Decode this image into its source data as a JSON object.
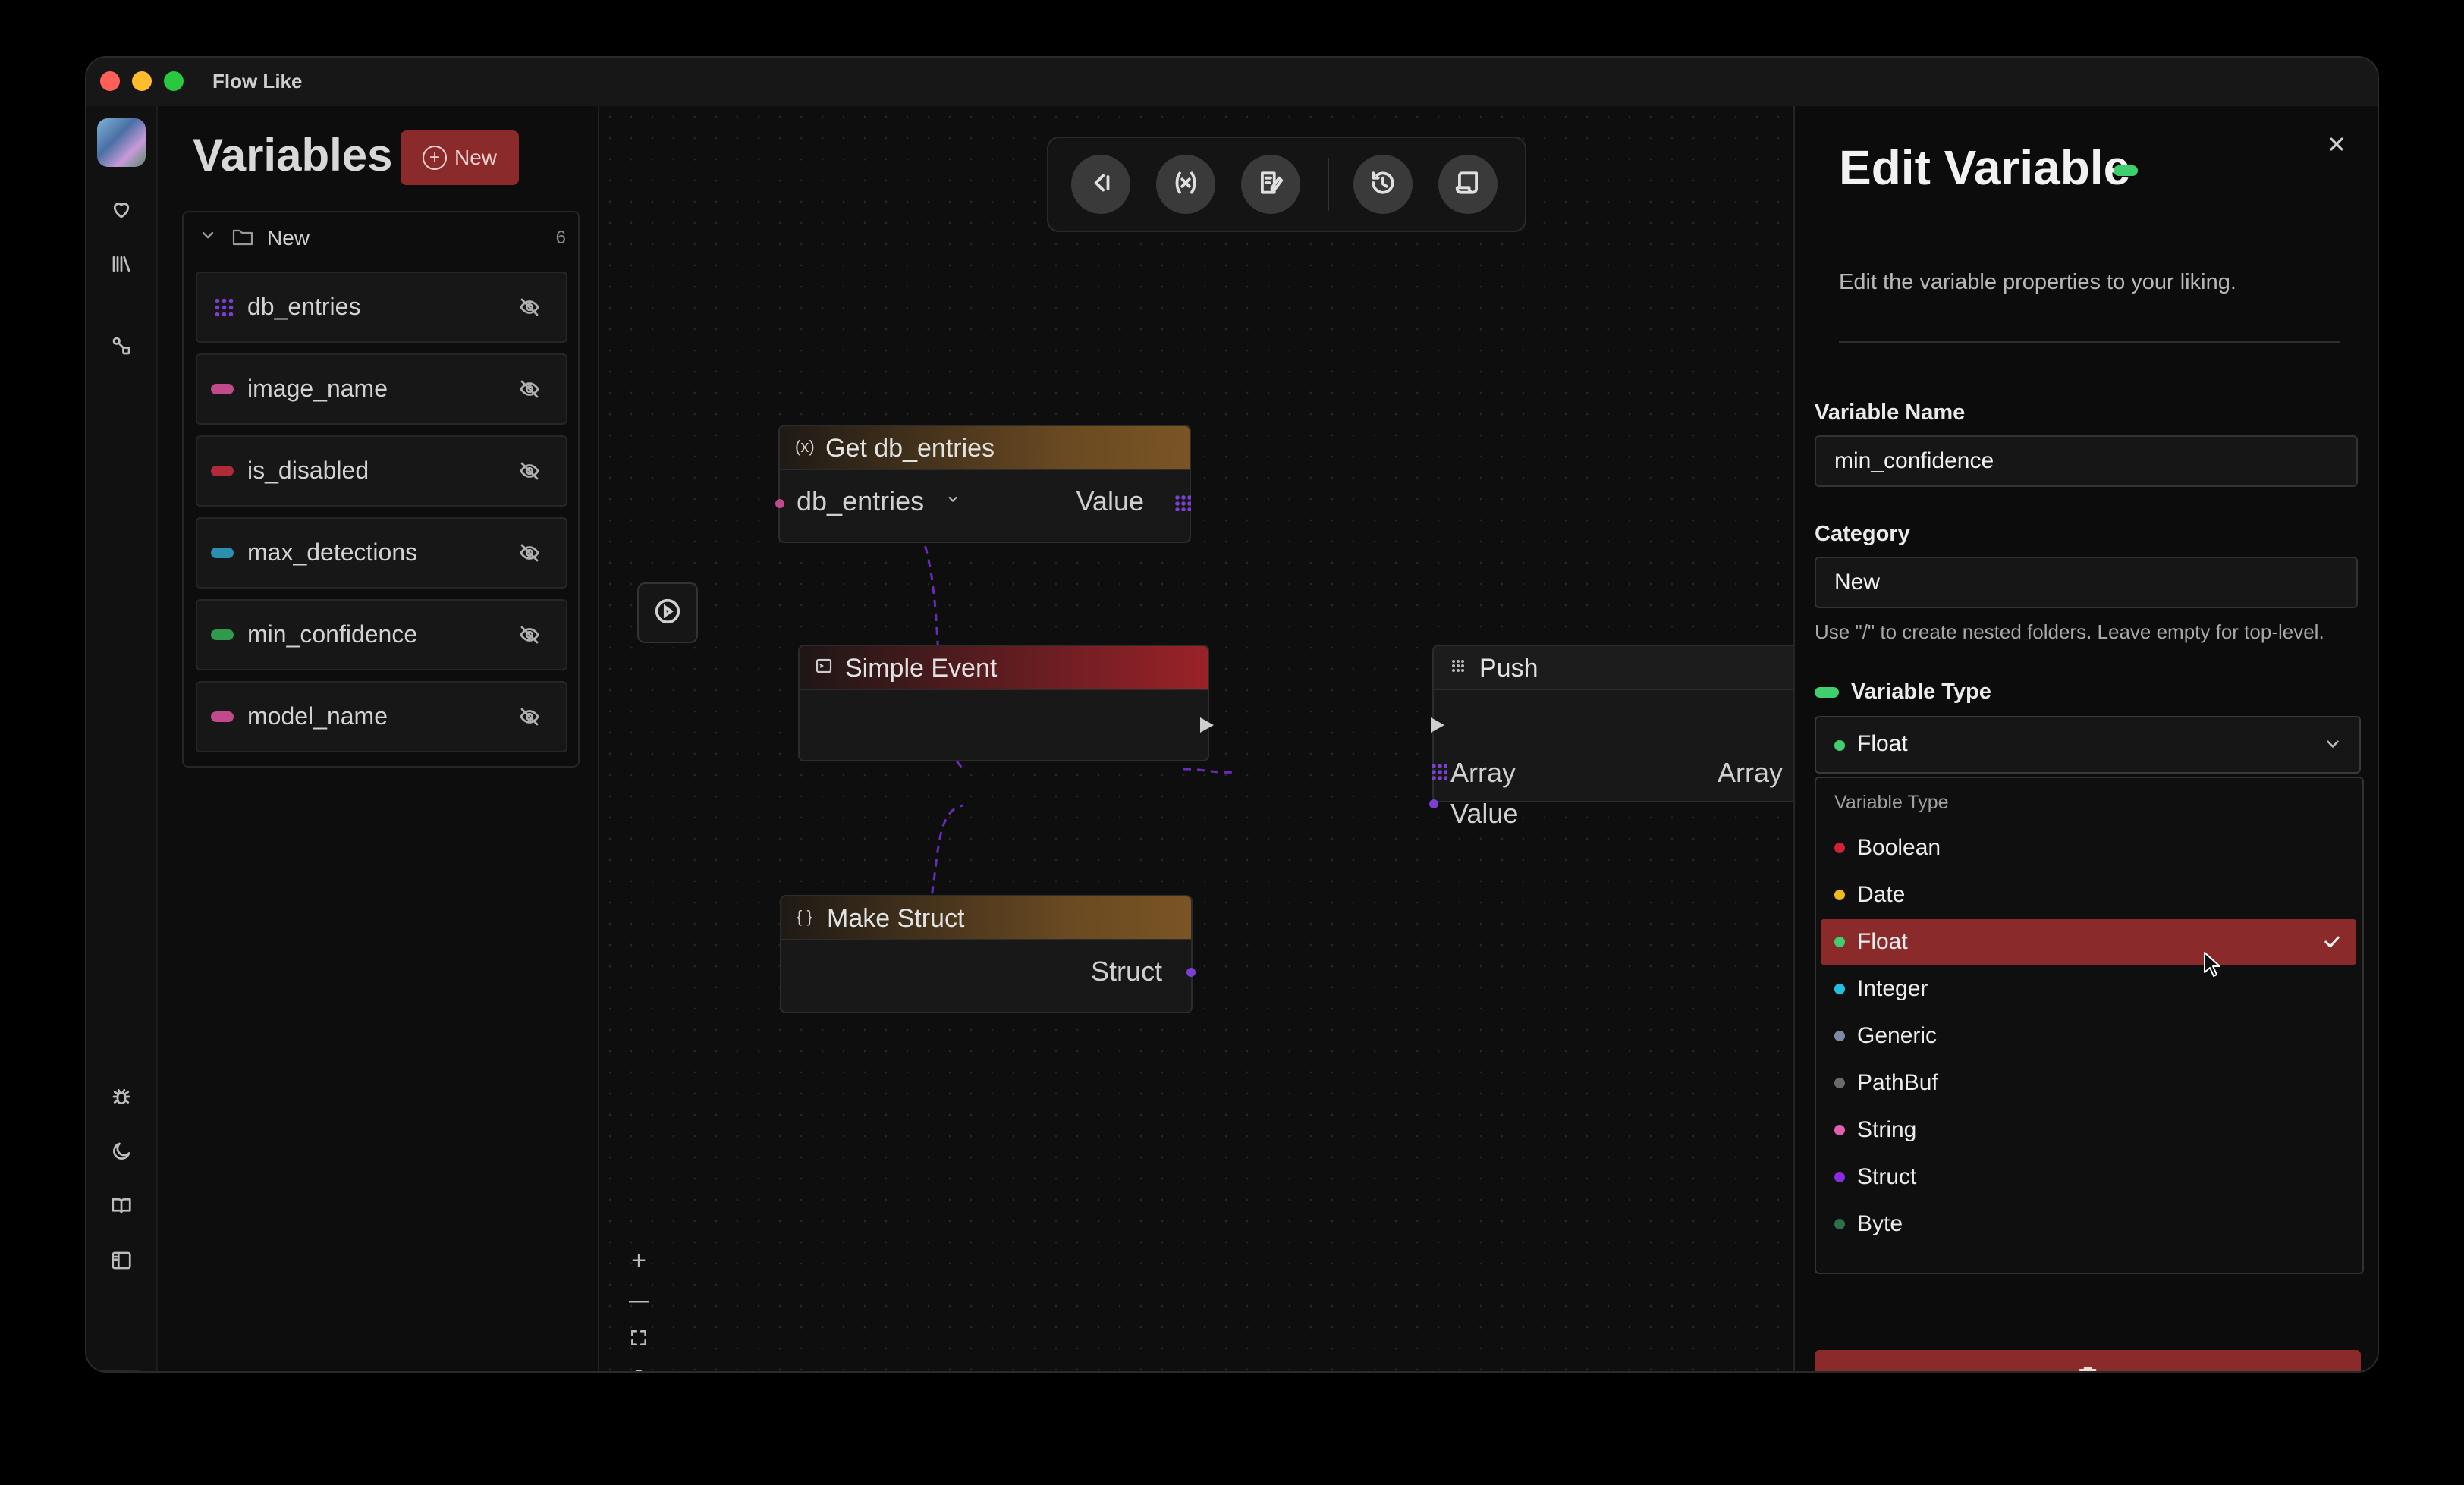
{
  "window": {
    "title": "Flow Like"
  },
  "rail": {
    "top_icons": [
      "app-logo",
      "heart-icon",
      "library-icon",
      "flow-icon"
    ],
    "bottom_icons": [
      "bug-icon",
      "moon-icon",
      "book-icon",
      "sidebar-toggle-icon",
      "user-avatar"
    ]
  },
  "variables": {
    "title": "Variables",
    "new_label": "New",
    "category": {
      "name": "New",
      "count": "6"
    },
    "items": [
      {
        "name": "db_entries",
        "kind": "grid",
        "color": "#7b3fd1"
      },
      {
        "name": "image_name",
        "kind": "dot",
        "color": "#c04a8a"
      },
      {
        "name": "is_disabled",
        "kind": "dot",
        "color": "#b02a3a"
      },
      {
        "name": "max_detections",
        "kind": "dot",
        "color": "#2a8fb0"
      },
      {
        "name": "min_confidence",
        "kind": "dot",
        "color": "#2f9a4e"
      },
      {
        "name": "model_name",
        "kind": "dot",
        "color": "#c04a8a"
      }
    ]
  },
  "canvas": {
    "toolbar_icons": [
      "back-icon",
      "variable-icon",
      "edit-notes-icon",
      "history-icon",
      "script-icon"
    ],
    "nodes": {
      "get_db_entries": {
        "title": "Get db_entries",
        "selector": "db_entries",
        "output": "Value"
      },
      "simple_event": {
        "title": "Simple Event"
      },
      "push": {
        "title": "Push",
        "input_array": "Array",
        "input_value": "Value",
        "output_array": "Array"
      },
      "make_struct": {
        "title": "Make Struct",
        "output": "Struct"
      }
    },
    "zoom": {
      "in": "+",
      "out": "—"
    }
  },
  "edit_panel": {
    "title": "Edit Variable",
    "subtitle": "Edit the variable properties to your liking.",
    "name_label": "Variable Name",
    "name_value": "min_confidence",
    "category_label": "Category",
    "category_value": "New",
    "category_hint": "Use \"/\" to create nested folders. Leave empty for top-level.",
    "type_label": "Variable Type",
    "type_value": "Float",
    "dropdown_header": "Variable Type",
    "type_options": [
      {
        "label": "Boolean",
        "color": "#d0203a",
        "selected": false
      },
      {
        "label": "Date",
        "color": "#f0b91a",
        "selected": false
      },
      {
        "label": "Float",
        "color": "#3fcf6e",
        "selected": true
      },
      {
        "label": "Integer",
        "color": "#22c0e0",
        "selected": false
      },
      {
        "label": "Generic",
        "color": "#7d8aa6",
        "selected": false
      },
      {
        "label": "PathBuf",
        "color": "#6a6a6a",
        "selected": false
      },
      {
        "label": "String",
        "color": "#e060b0",
        "selected": false
      },
      {
        "label": "Struct",
        "color": "#8a2be2",
        "selected": false
      },
      {
        "label": "Byte",
        "color": "#2e6e4a",
        "selected": false
      }
    ]
  }
}
